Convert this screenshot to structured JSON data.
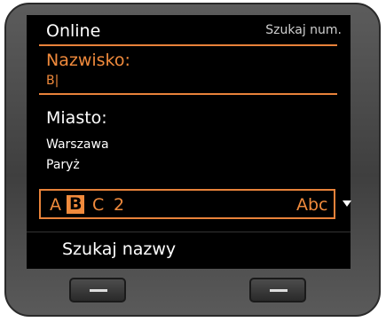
{
  "header": {
    "title": "Online",
    "right_label": "Szukaj num."
  },
  "surname": {
    "label": "Nazwisko:",
    "value": "B|"
  },
  "city": {
    "label": "Miasto:",
    "options": [
      "Warszawa",
      "Paryż"
    ]
  },
  "keyboard": {
    "keys": [
      "A",
      "B",
      "C",
      "2"
    ],
    "selected": "B",
    "mode": "Abc"
  },
  "softkey": {
    "label": "Szukaj nazwy"
  },
  "colors": {
    "accent": "#f08a3c",
    "screen": "#000000",
    "bezel": "#4a4a4a"
  },
  "icons": {
    "scroll": "triangle-down-icon",
    "softkey": "minus-icon"
  }
}
